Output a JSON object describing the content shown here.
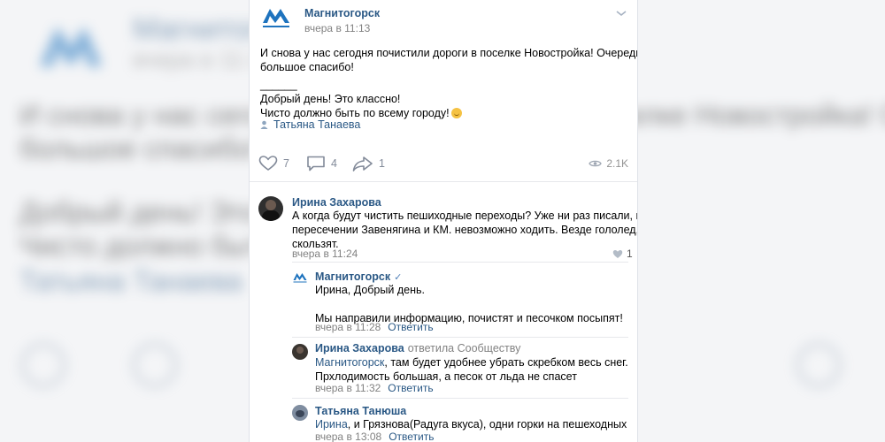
{
  "post": {
    "group_name": "Магнитогорск",
    "time": "вчера в 11:13",
    "text_lines": [
      "И снова у нас сегодня почистили дороги в поселке Новостройка! Очередное",
      "большое спасибо!",
      "______",
      "Добрый день! Это классно!",
      "Чисто должно быть по всему городу!"
    ],
    "signer": "Татьяна Танаева",
    "likes": "7",
    "comments": "4",
    "shares": "1",
    "views": "2.1K"
  },
  "comments": [
    {
      "author": "Ирина Захарова",
      "text_lines": [
        "А когда будут чистить пешиходные переходы? Уже ни раз писали, на",
        "пересечении Завенягина и КМ. невозможно ходить. Везде гололед, все",
        "скользят."
      ],
      "time": "вчера в 11:24",
      "likes": "1"
    },
    {
      "author": "Магнитогорск",
      "verified_mark": "✓",
      "text_lines": [
        "Ирина, Добрый день.",
        "",
        "Мы направили информацию, почистят и песочком посыпят!"
      ],
      "time": "вчера в 11:28",
      "reply_label": "Ответить"
    },
    {
      "author": "Ирина Захарова",
      "replied_to": "ответила Сообществу",
      "mention": "Магнитогорск",
      "text_line1_rest": ", там будет удобнее убрать скребком весь снег.",
      "text_line2": "Прхлодимость большая, а песок от льда не спасет",
      "time": "вчера в 11:32",
      "reply_label": "Ответить"
    },
    {
      "author": "Татьяна Танюша",
      "mention": "Ирина",
      "text_rest": ", и Грязнова(Радуга вкуса), одни горки на пешеходных",
      "time": "вчера в 13:08",
      "reply_label": "Ответить"
    }
  ],
  "colors": {
    "link": "#2a5885",
    "muted": "#828282",
    "icon": "#828a99",
    "brand": "#1e73be"
  },
  "icons": [
    "chevron-down-icon",
    "heart-icon",
    "comment-icon",
    "share-icon",
    "eye-icon",
    "person-icon",
    "verified-icon"
  ]
}
